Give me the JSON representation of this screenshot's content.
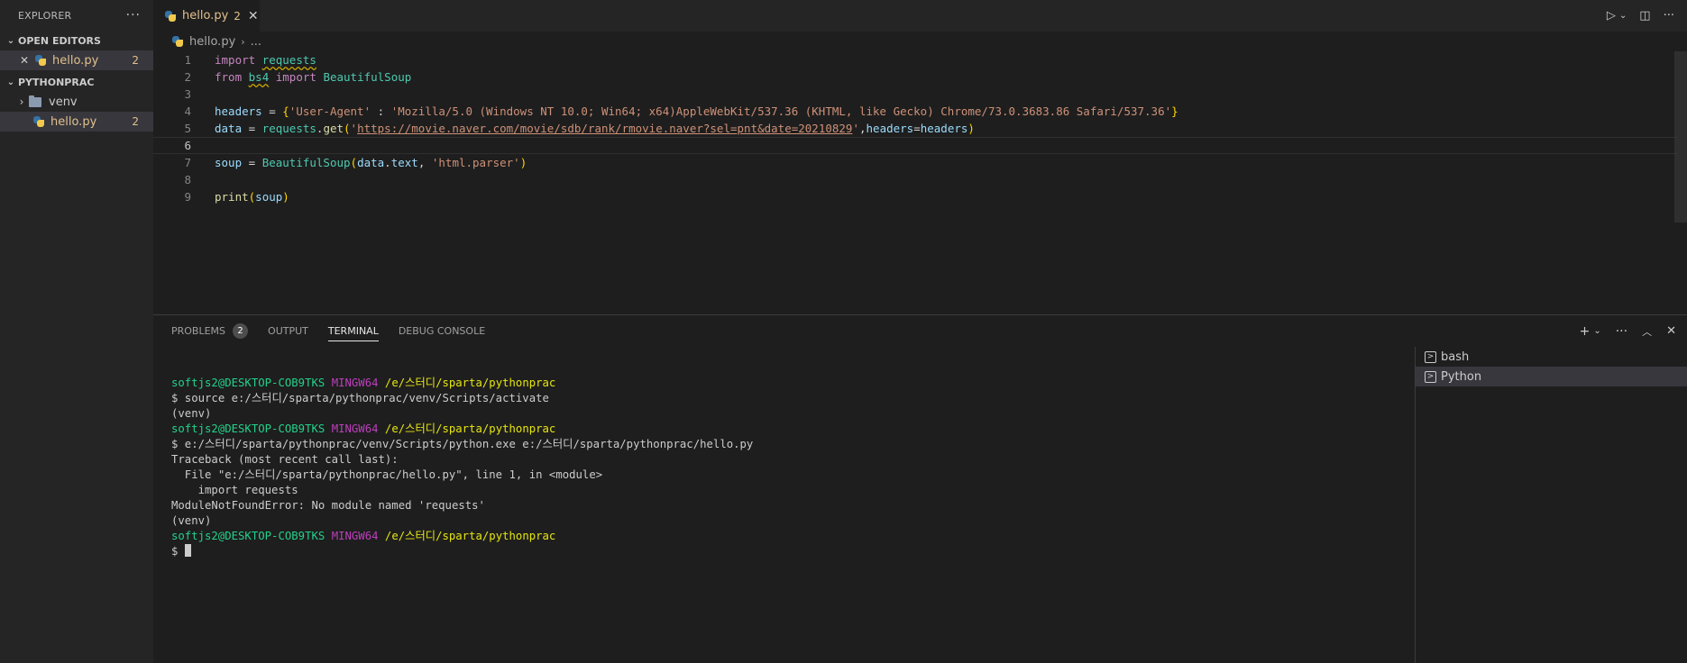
{
  "sidebar": {
    "title": "EXPLORER",
    "more": "···",
    "open_editors": {
      "title": "OPEN EDITORS",
      "items": [
        {
          "name": "hello.py",
          "count": "2"
        }
      ]
    },
    "project": {
      "title": "PYTHONPRAC",
      "items": [
        {
          "name": "venv",
          "type": "folder"
        },
        {
          "name": "hello.py",
          "count": "2",
          "type": "file"
        }
      ]
    }
  },
  "tabs": [
    {
      "label": "hello.py",
      "count": "2",
      "close": "✕"
    }
  ],
  "breadcrumb": {
    "file": "hello.py",
    "rest": "..."
  },
  "editor": {
    "line_numbers": [
      "1",
      "2",
      "3",
      "4",
      "5",
      "6",
      "7",
      "8",
      "9"
    ],
    "lines": {
      "l1_import": "import",
      "l1_mod": "requests",
      "l2_from": "from",
      "l2_mod": "bs4",
      "l2_import": "import",
      "l2_cls": "BeautifulSoup",
      "l4_var": "headers",
      "l4_eq": " = ",
      "l4_open": "{",
      "l4_key": "'User-Agent'",
      "l4_colon": " : ",
      "l4_val": "'Mozilla/5.0 (Windows NT 10.0; Win64; x64)AppleWebKit/537.36 (KHTML, like Gecko) Chrome/73.0.3683.86 Safari/537.36'",
      "l4_close": "}",
      "l5_var": "data",
      "l5_eq": " = ",
      "l5_obj": "requests",
      "l5_dot": ".",
      "l5_fn": "get",
      "l5_open": "(",
      "l5_q1": "'",
      "l5_url": "https://movie.naver.com/movie/sdb/rank/rmovie.naver?sel=pnt&date=20210829",
      "l5_q2": "'",
      "l5_comma": ",",
      "l5_kw": "headers",
      "l5_eq2": "=",
      "l5_arg": "headers",
      "l5_close": ")",
      "l7_var": "soup",
      "l7_eq": " = ",
      "l7_cls": "BeautifulSoup",
      "l7_open": "(",
      "l7_a1": "data",
      "l7_dot": ".",
      "l7_a1b": "text",
      "l7_comma": ", ",
      "l7_str": "'html.parser'",
      "l7_close": ")",
      "l9_fn": "print",
      "l9_open": "(",
      "l9_arg": "soup",
      "l9_close": ")"
    }
  },
  "panel": {
    "tabs": [
      "PROBLEMS",
      "OUTPUT",
      "TERMINAL",
      "DEBUG CONSOLE"
    ],
    "problems_count": "2",
    "active_tab": "TERMINAL"
  },
  "terminal": {
    "user": "softjs2@DESKTOP-COB9TKS",
    "env": "MINGW64",
    "path1": "/e/스터디/sparta/pythonprac",
    "cmd1": "$ source e:/스터디/sparta/pythonprac/venv/Scripts/activate",
    "venv": "(venv)",
    "cmd2": "$ e:/스터디/sparta/pythonprac/venv/Scripts/python.exe e:/스터디/sparta/pythonprac/hello.py",
    "tb1": "Traceback (most recent call last):",
    "tb2": "  File \"e:/스터디/sparta/pythonprac/hello.py\", line 1, in <module>",
    "tb3": "    import requests",
    "tb4": "ModuleNotFoundError: No module named 'requests'",
    "prompt": "$ "
  },
  "terminal_list": [
    {
      "name": "bash"
    },
    {
      "name": "Python",
      "selected": true
    }
  ]
}
